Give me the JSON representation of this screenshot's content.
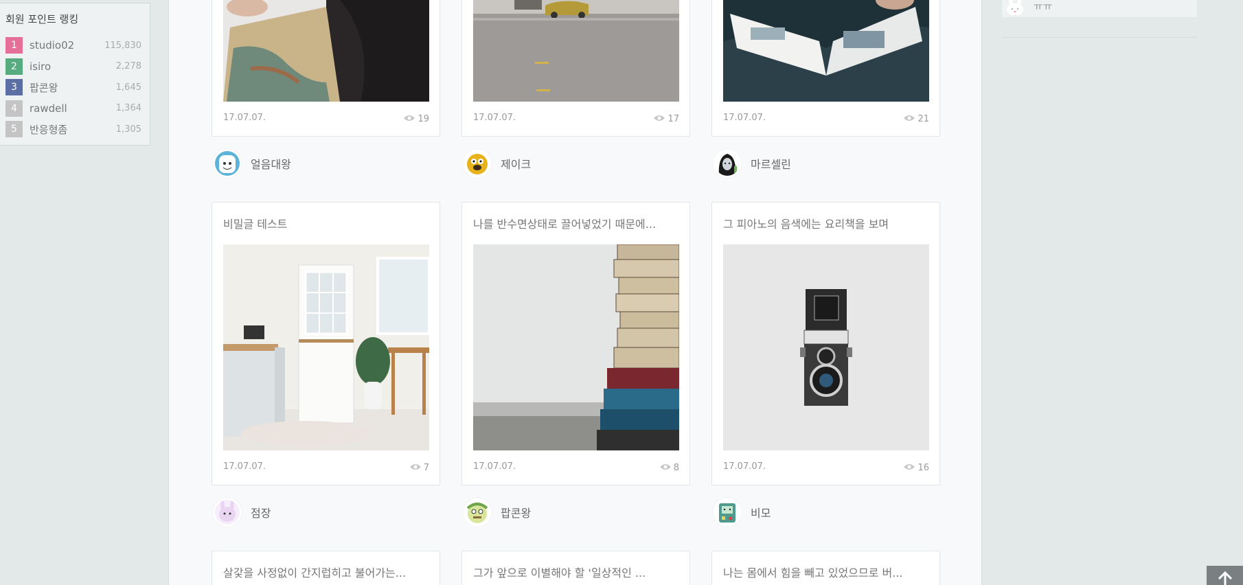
{
  "ranking": {
    "title": "회원 포인트 랭킹",
    "items": [
      {
        "rank": "1",
        "name": "studio02",
        "points": "115,830",
        "color": "#e56f96"
      },
      {
        "rank": "2",
        "name": "isiro",
        "points": "2,278",
        "color": "#56ac7e"
      },
      {
        "rank": "3",
        "name": "팝콘왕",
        "points": "1,645",
        "color": "#5b6fa5"
      },
      {
        "rank": "4",
        "name": "rawdell",
        "points": "1,364",
        "color": "#c4c4c4"
      },
      {
        "rank": "5",
        "name": "반응형좀",
        "points": "1,305",
        "color": "#c4c4c4"
      }
    ]
  },
  "cards": [
    {
      "title": "",
      "date": "17.07.07.",
      "views": "19",
      "image": "map-book-photo",
      "author": "얼음대왕"
    },
    {
      "title": "",
      "date": "17.07.07.",
      "views": "17",
      "image": "street-car-photo",
      "author": "제이크"
    },
    {
      "title": "",
      "date": "17.07.07.",
      "views": "21",
      "image": "reading-magazine-photo",
      "author": "마르셀린"
    },
    {
      "title": "비밀글 테스트",
      "date": "17.07.07.",
      "views": "7",
      "image": "kitchen-door-photo",
      "author": "점장"
    },
    {
      "title": "나를 반수면상태로 끌어넣었기 때문에...",
      "date": "17.07.07.",
      "views": "8",
      "image": "book-stack-photo",
      "author": "팝콘왕"
    },
    {
      "title": "그 피아노의 음색에는 요리책을 보며",
      "date": "17.07.07.",
      "views": "16",
      "image": "camera-photo",
      "author": "비모"
    },
    {
      "title": "살갗을 사정없이 간지럽히고 불어가는...",
      "author": ""
    },
    {
      "title": "그가 앞으로 이별해야 할 '일상적인 ...",
      "author": ""
    },
    {
      "title": "나는 몸에서 힘을 빼고 있었으므로 버...",
      "author": ""
    }
  ],
  "right": {
    "snippet": "ㅠㅠ"
  },
  "icons": {
    "views": "eye-icon",
    "scroll_top": "arrow-up-icon"
  }
}
